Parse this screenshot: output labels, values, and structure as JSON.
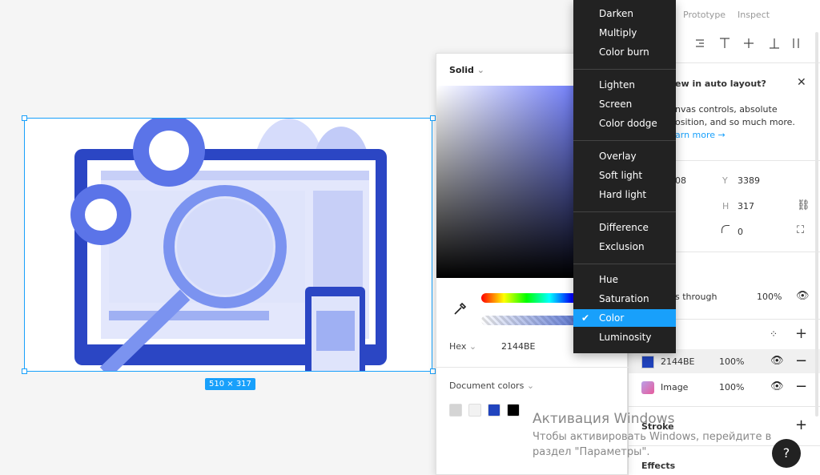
{
  "canvas": {
    "size_badge": "510 × 317"
  },
  "color_picker": {
    "fill_type": "Solid",
    "format_label": "Hex",
    "hex_value": "2144BE",
    "document_colors_label": "Document colors",
    "document_colors": [
      "#d4d4d4",
      "#f2f2f2",
      "#2144be",
      "#000000"
    ]
  },
  "blend_menu": {
    "groups": [
      [
        "Darken",
        "Multiply",
        "Color burn"
      ],
      [
        "Lighten",
        "Screen",
        "Color dodge"
      ],
      [
        "Overlay",
        "Soft light",
        "Hard light"
      ],
      [
        "Difference",
        "Exclusion"
      ],
      [
        "Hue",
        "Saturation",
        "Color",
        "Luminosity"
      ]
    ],
    "selected": "Color"
  },
  "right_panel": {
    "tabs": [
      "Prototype",
      "Inspect"
    ],
    "banner_title": "ew in auto layout?",
    "banner_line1": "nvas controls, absolute",
    "banner_line2": "osition, and so much more.",
    "banner_link": "arn more →",
    "x_value": "08",
    "y_label": "Y",
    "y_value": "3389",
    "h_label": "H",
    "h_value": "317",
    "radius_value": "0",
    "layer_mode": "s through",
    "layer_opacity": "100%",
    "fills": [
      {
        "name": "2144BE",
        "opacity": "100%",
        "color": "#2144be"
      },
      {
        "name": "Image",
        "opacity": "100%"
      }
    ],
    "stroke_label": "Stroke",
    "effects_label": "Effects"
  },
  "watermark": {
    "title": "Активация Windows",
    "line1": "Чтобы активировать Windows, перейдите в",
    "line2": "раздел \"Параметры\"."
  },
  "help_label": "?"
}
